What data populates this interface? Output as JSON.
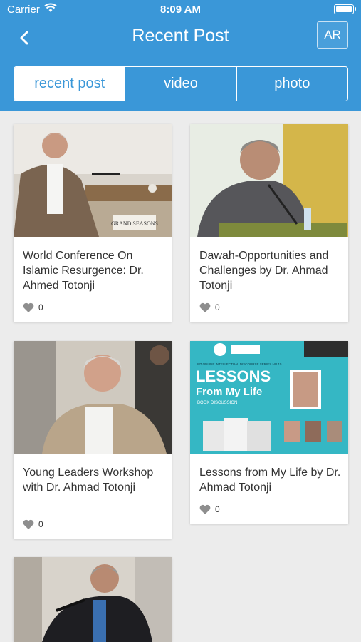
{
  "status_bar": {
    "carrier": "Carrier",
    "time": "8:09 AM"
  },
  "header": {
    "title": "Recent Post",
    "lang_button": "AR"
  },
  "tabs": [
    {
      "label": "recent post",
      "active": true
    },
    {
      "label": "video",
      "active": false
    },
    {
      "label": "photo",
      "active": false
    }
  ],
  "posts": [
    {
      "title": "World Conference On Islamic Resurgence: Dr. Ahmed Totonji",
      "likes": "0"
    },
    {
      "title": "Dawah-Opportunities and Challenges by Dr. Ahmad Totonji",
      "likes": "0"
    },
    {
      "title": "Young Leaders Workshop with Dr. Ahmad Totonji",
      "likes": "0"
    },
    {
      "title": "Lessons from My Life by Dr. Ahmad Totonji",
      "likes": "0"
    },
    {
      "title": "",
      "likes": ""
    }
  ],
  "poster": {
    "header_text": "IIIT ONLINE INTELLECTUAL DISCOURSE SERIES NO.15",
    "title_line1": "LESSONS",
    "title_line2": "From My Life",
    "subtitle": "BOOK DISCUSSION",
    "podium_sign": "GRAND SEASONS"
  },
  "colors": {
    "primary": "#3a97d8",
    "background": "#ececec",
    "card": "#ffffff"
  }
}
